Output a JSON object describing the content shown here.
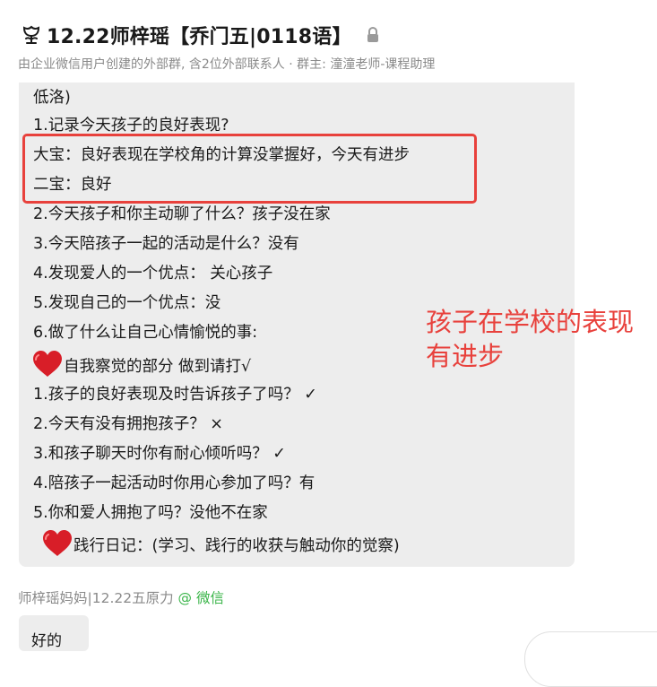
{
  "header": {
    "title": "12.22师梓瑶【乔门五|0118语】",
    "subtitle": "由企业微信用户创建的外部群, 含2位外部联系人 · 群主: 潼潼老师-课程助理"
  },
  "message": {
    "lines": [
      "低洛)",
      " 1.记录今天孩子的良好表现?",
      "大宝：良好表现在学校角的计算没掌握好，今天有进步",
      " 二宝：良好",
      " 2.今天孩子和你主动聊了什么？孩子没在家",
      " 3.今天陪孩子一起的活动是什么？没有",
      "  4.发现爱人的一个优点：  关心孩子",
      " 5.发现自己的一个优点：没",
      "  6.做了什么让自己心情愉悦的事:",
      "自我察觉的部分 做到请打√",
      " 1.孩子的良好表现及时告诉孩子了吗？ ✓",
      " 2.今天有没有拥抱孩子？ ×",
      "  3.和孩子聊天时你有耐心倾听吗？ ✓",
      " 4.陪孩子一起活动时你用心参加了吗？有",
      "  5.你和爱人拥抱了吗？没他不在家",
      "践行日记：(学习、践行的收获与触动你的觉察)"
    ]
  },
  "annotation": "孩子在学校的表现有进步",
  "next_message": {
    "sender_name": "师梓瑶妈妈|12.22五原力",
    "sender_source": "@ 微信",
    "text": "好的"
  },
  "colors": {
    "highlight": "#e8413c",
    "bubble": "#ededed",
    "wechat_green": "#3bb54a"
  }
}
